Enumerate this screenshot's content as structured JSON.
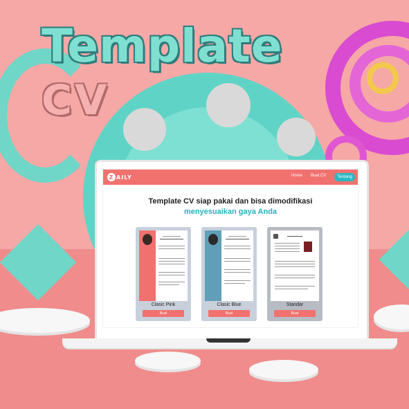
{
  "banner": {
    "title": "Template",
    "subtitle": "CV"
  },
  "app": {
    "brand": "AILY",
    "brand_mark": "Z",
    "nav": {
      "home": "Home",
      "create_cv": "Buat CV",
      "about": "Tentang"
    },
    "headline_line1": "Template CV siap pakai dan bisa dimodifikasi",
    "headline_line2": "menyesuaikan gaya Anda",
    "templates": [
      {
        "name": "Clasic Pink",
        "button": "Buat",
        "accent": "#f1716f"
      },
      {
        "name": "Clasic Blue",
        "button": "Buat",
        "accent": "#5f9fb8"
      },
      {
        "name": "Standar",
        "button": "Buat",
        "accent": "#555555"
      }
    ]
  },
  "colors": {
    "primary": "#f1716f",
    "secondary": "#2ab8c3",
    "teal": "#5fd4c6",
    "pink_bg": "#f5a8a6"
  }
}
